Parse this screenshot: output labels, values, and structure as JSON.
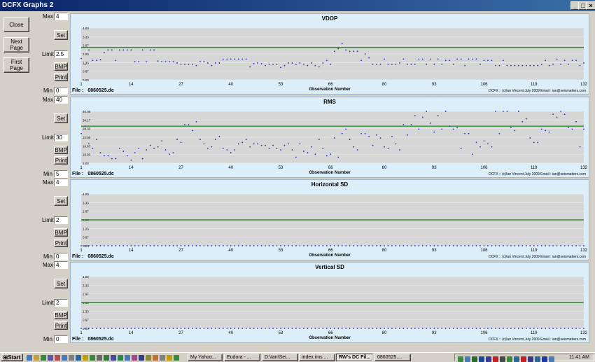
{
  "window": {
    "title": "DCFX Graphs 2"
  },
  "side_buttons": {
    "close": "Close",
    "next_page": "Next Page",
    "first_page": "First Page"
  },
  "controls": {
    "max_label": "Max",
    "limit_label": "Limit",
    "min_label": "Min",
    "set_label": "Set",
    "bmp_label": "BMP",
    "print_label": "Print"
  },
  "panels": [
    {
      "key": "vdop",
      "title": "VDOP",
      "max": "4",
      "limit": "2.5",
      "min": "0",
      "file_label": "File :",
      "file": "0860525.dc",
      "xlabel": "Observation Number",
      "credit": "DCFX :: (c)Ian Vincent July 2009 Email : ian@seismatters.com"
    },
    {
      "key": "rms",
      "title": "RMS",
      "max": "40",
      "limit": "30",
      "min": "5",
      "file_label": "File :",
      "file": "0860525.dc",
      "xlabel": "Observation Number",
      "credit": "DCFX :: (c)Ian Vincent July 2009 Email : ian@seismatters.com"
    },
    {
      "key": "hsd",
      "title": "Horizontal SD",
      "max": "4",
      "limit": "2",
      "min": "0",
      "file_label": "File :",
      "file": "0860525.dc",
      "xlabel": "Observation Number",
      "credit": "DCFX :: (c)Ian Vincent July 2009 Email : ian@seismatters.com"
    },
    {
      "key": "vsd",
      "title": "Vertical SD",
      "max": "4",
      "limit": "2",
      "min": "0",
      "file_label": "File :",
      "file": "0860525.dc",
      "xlabel": "Observation Number",
      "credit": "DCFX :: (c)Ian Vincent July 2009 Email : ian@seismatters.com"
    }
  ],
  "chart_data": [
    {
      "type": "scatter",
      "title": "VDOP",
      "xlabel": "Observation Number",
      "x_ticks": [
        "1",
        "14",
        "27",
        "40",
        "53",
        "66",
        "80",
        "93",
        "106",
        "119",
        "132"
      ],
      "y_ticks": [
        "0.00",
        "0.67",
        "1.33",
        "2.00",
        "2.67",
        "3.33",
        "4.00"
      ],
      "ylim": [
        0,
        4
      ],
      "xlim": [
        1,
        132
      ],
      "limit_line": 2.5,
      "limit_color": "#2e8b2e",
      "point_color": "#1a2acc",
      "values": [
        1.65,
        1.2,
        2.3,
        1.5,
        1.5,
        1.55,
        2.1,
        2.3,
        2.3,
        1.5,
        2.3,
        2.3,
        2.3,
        2.3,
        1.4,
        1.4,
        2.3,
        1.4,
        2.3,
        2.3,
        1.45,
        1.4,
        1.4,
        1.4,
        1.4,
        1.3,
        1.2,
        1.2,
        1.2,
        1.2,
        1.1,
        1.4,
        1.4,
        1.3,
        1.1,
        1.3,
        1.3,
        1.6,
        1.6,
        1.6,
        1.6,
        1.6,
        1.6,
        1.6,
        1.0,
        1.25,
        1.3,
        1.25,
        1.1,
        1.2,
        1.2,
        1.2,
        0.95,
        1.1,
        1.3,
        1.3,
        1.2,
        1.3,
        1.2,
        1.1,
        1.3,
        1.1,
        1.0,
        1.3,
        1.5,
        1.2,
        2.2,
        2.4,
        2.8,
        2.3,
        2.2,
        2.2,
        2.2,
        1.5,
        2.0,
        1.7,
        1.2,
        1.2,
        1.2,
        1.6,
        1.2,
        1.2,
        1.2,
        1.3,
        1.6,
        1.2,
        1.2,
        1.2,
        1.6,
        1.6,
        1.2,
        1.6,
        1.2,
        1.6,
        1.2,
        1.5,
        1.5,
        1.2,
        1.6,
        1.6,
        1.1,
        1.6,
        1.6,
        1.6,
        1.2,
        1.5,
        1.5,
        1.5,
        1.1,
        1.1,
        1.5,
        1.1,
        1.1,
        1.1,
        1.1,
        1.1,
        1.1,
        1.1,
        1.1,
        1.1,
        1.2,
        1.5,
        1.1,
        1.2,
        1.6,
        1.2,
        1.5,
        1.2,
        1.5,
        1.5,
        1.1,
        1.3
      ]
    },
    {
      "type": "scatter",
      "title": "RMS",
      "xlabel": "Observation Number",
      "x_ticks": [
        "1",
        "14",
        "27",
        "40",
        "53",
        "66",
        "80",
        "93",
        "106",
        "119",
        "132"
      ],
      "y_ticks": [
        "5.00",
        "10.83",
        "16.67",
        "22.50",
        "28.33",
        "34.17",
        "40.00"
      ],
      "ylim": [
        5,
        40
      ],
      "xlim": [
        1,
        132
      ],
      "limit_line": 30,
      "limit_color": "#2e8b2e",
      "point_color": "#1a2acc",
      "values": [
        25,
        30,
        18,
        15,
        21,
        12,
        10,
        10,
        8,
        8,
        15,
        13,
        10,
        7,
        12,
        15,
        8,
        14,
        17,
        15,
        16,
        20,
        14,
        11,
        12,
        21,
        19,
        31,
        31,
        27,
        33,
        21,
        18,
        15,
        16,
        21,
        23,
        15,
        14,
        12,
        14,
        18,
        19,
        21,
        16,
        18,
        18,
        17,
        17,
        15,
        17,
        15,
        14,
        17,
        18,
        14,
        9,
        18,
        13,
        12,
        16,
        11,
        21,
        15,
        10,
        11,
        22,
        9,
        25,
        28,
        21,
        16,
        14,
        25,
        25,
        23,
        17,
        24,
        22,
        16,
        15,
        23,
        18,
        14,
        31,
        24,
        31,
        37,
        28,
        36,
        41,
        32,
        26,
        37,
        28,
        42,
        30,
        28,
        29,
        15,
        25,
        25,
        11,
        19,
        16,
        20,
        18,
        16,
        42,
        25,
        40,
        44,
        29,
        27,
        42,
        33,
        35,
        22,
        19,
        19,
        28,
        27,
        26,
        38,
        36,
        40,
        38,
        29,
        28,
        33,
        16,
        28,
        33,
        27,
        19,
        10
      ]
    },
    {
      "type": "scatter",
      "title": "Horizontal SD",
      "xlabel": "Observation Number",
      "x_ticks": [
        "1",
        "14",
        "27",
        "40",
        "53",
        "66",
        "80",
        "93",
        "106",
        "119",
        "132"
      ],
      "y_ticks": [
        "0.00",
        "0.67",
        "1.33",
        "2.00",
        "2.67",
        "3.33",
        "4.00"
      ],
      "ylim": [
        0,
        4
      ],
      "xlim": [
        1,
        132
      ],
      "limit_line": 2,
      "limit_color": "#2e8b2e",
      "point_color": "#1a2acc",
      "values_all": 0
    },
    {
      "type": "scatter",
      "title": "Vertical SD",
      "xlabel": "Observation Number",
      "x_ticks": [
        "1",
        "14",
        "27",
        "40",
        "53",
        "66",
        "80",
        "93",
        "106",
        "119",
        "132"
      ],
      "y_ticks": [
        "0.00",
        "0.67",
        "1.33",
        "2.00",
        "2.67",
        "3.33",
        "4.00"
      ],
      "ylim": [
        0,
        4
      ],
      "xlim": [
        1,
        132
      ],
      "limit_line": 2,
      "limit_color": "#2e8b2e",
      "point_color": "#1a2acc",
      "values_all": 0
    }
  ],
  "taskbar": {
    "start": "Start",
    "tasks": [
      "My Yahoo...",
      "Eudora - ...",
      "D:\\Ian\\Sei...",
      "index.ims ...",
      "RW's DC Fil...",
      "0860525...."
    ],
    "clock": "11:41 AM"
  }
}
